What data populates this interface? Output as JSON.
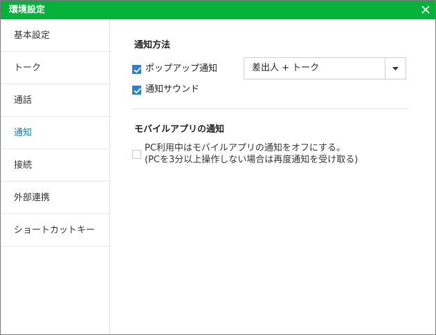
{
  "window": {
    "title": "環境設定",
    "accent_color": "#06b33a",
    "close_icon": "close-icon"
  },
  "sidebar": {
    "items": [
      {
        "label": "基本設定",
        "active": false
      },
      {
        "label": "トーク",
        "active": false
      },
      {
        "label": "通話",
        "active": false
      },
      {
        "label": "通知",
        "active": true
      },
      {
        "label": "接続",
        "active": false
      },
      {
        "label": "外部連携",
        "active": false
      },
      {
        "label": "ショートカットキー",
        "active": false
      }
    ],
    "active_color": "#1a73c8"
  },
  "notification_method": {
    "title": "通知方法",
    "popup": {
      "label": "ポップアップ通知",
      "checked": true
    },
    "sound": {
      "label": "通知サウンド",
      "checked": true
    },
    "popup_style": {
      "selected": "差出人 + トーク",
      "icon": "chevron-down-icon"
    }
  },
  "mobile_app": {
    "title": "モバイルアプリの通知",
    "option": {
      "line1": "PC利用中はモバイルアプリの通知をオフにする。",
      "line2": "(PCを3分以上操作しない場合は再度通知を受け取る)",
      "checked": false
    }
  },
  "colors": {
    "checkbox_checked": "#2b7fd0"
  }
}
